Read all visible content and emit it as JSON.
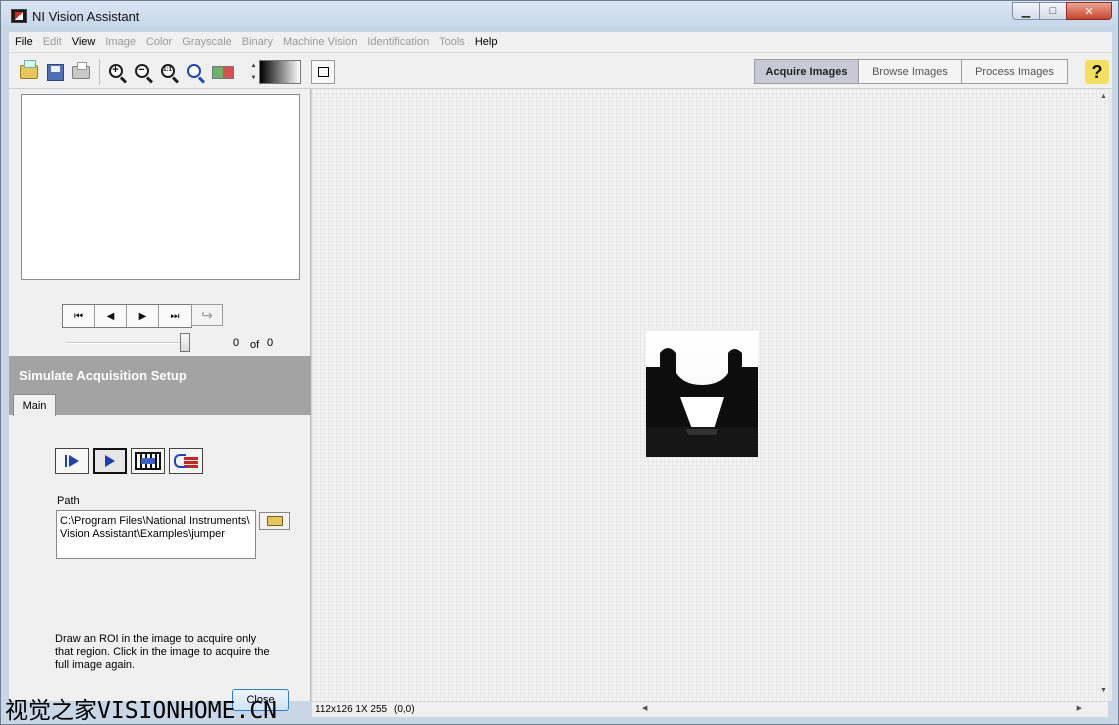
{
  "window": {
    "title": "NI Vision Assistant",
    "minimize": "▁",
    "maximize": "□",
    "close": "✕"
  },
  "menu": [
    {
      "label": "File",
      "enabled": true
    },
    {
      "label": "Edit",
      "enabled": false
    },
    {
      "label": "View",
      "enabled": true
    },
    {
      "label": "Image",
      "enabled": false
    },
    {
      "label": "Color",
      "enabled": false
    },
    {
      "label": "Grayscale",
      "enabled": false
    },
    {
      "label": "Binary",
      "enabled": false
    },
    {
      "label": "Machine Vision",
      "enabled": false
    },
    {
      "label": "Identification",
      "enabled": false
    },
    {
      "label": "Tools",
      "enabled": false
    },
    {
      "label": "Help",
      "enabled": true
    }
  ],
  "toolbar": {
    "icons": [
      "open-image-icon",
      "save-image-icon",
      "print-icon",
      "zoom-in-icon",
      "zoom-out-icon",
      "zoom-1to1-icon",
      "zoom-fit-icon",
      "palette-icon",
      "gradient-palette-icon",
      "rectangle-roi-icon"
    ],
    "zoom_in_glyph": "+",
    "zoom_out_glyph": "−",
    "zoom_1to1_glyph": "1:1",
    "tabs": [
      {
        "label": "Acquire Images",
        "active": true
      },
      {
        "label": "Browse Images",
        "active": false
      },
      {
        "label": "Process Images",
        "active": false
      }
    ],
    "help_label": "?"
  },
  "browser": {
    "nav": {
      "first": "⏮",
      "prev": "◀",
      "next": "▶",
      "last": "⏭",
      "return": "↪"
    },
    "current_index": "0",
    "of_label": "of",
    "total": "0"
  },
  "setup": {
    "title": "Simulate Acquisition Setup",
    "tab": "Main",
    "path_label": "Path",
    "path_value": "C:\\Program Files\\National Instruments\\\nVision Assistant\\Examples\\jumper",
    "hint": "Draw an ROI in the image to acquire only that region. Click in the image to acquire the full image again.",
    "close_label": "Close"
  },
  "status": {
    "image_info": "112x126 1X 255",
    "coordinates": "(0,0)",
    "scroll_left": "◀",
    "scroll_right": "▶",
    "scroll_up": "▲",
    "scroll_down": "▼"
  },
  "watermark": "视觉之家VISIONHOME.CN"
}
